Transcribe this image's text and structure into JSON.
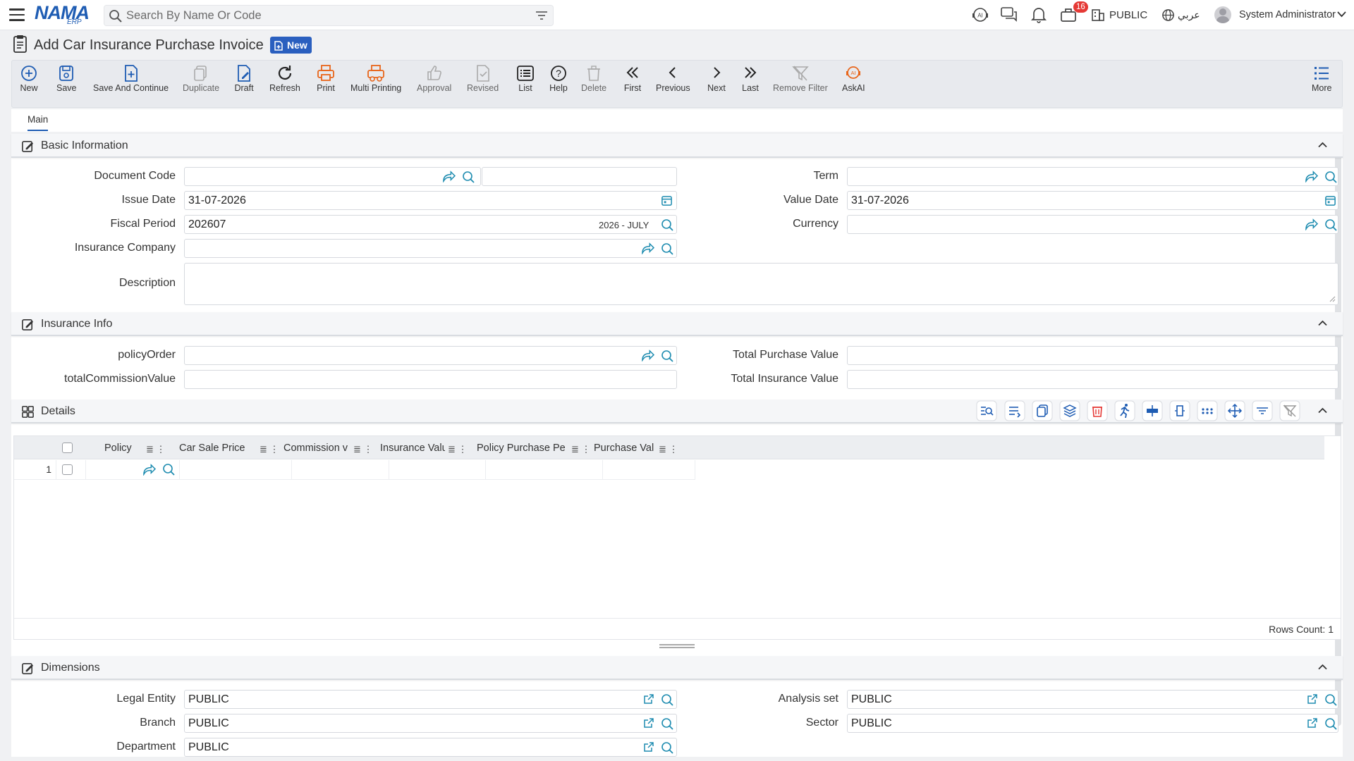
{
  "topbar": {
    "logo_main": "NAMA",
    "logo_sub": "ERP",
    "search_placeholder": "Search By Name Or Code",
    "notification_count": "16",
    "company": "PUBLIC",
    "language": "عربي",
    "user": "System Administrator"
  },
  "page": {
    "title": "Add Car Insurance Purchase Invoice",
    "status_badge": "New"
  },
  "toolbar": [
    {
      "label": "New"
    },
    {
      "label": "Save"
    },
    {
      "label": "Save And Continue"
    },
    {
      "label": "Duplicate"
    },
    {
      "label": "Draft"
    },
    {
      "label": "Refresh"
    },
    {
      "label": "Print"
    },
    {
      "label": "Multi Printing"
    },
    {
      "label": "Approval"
    },
    {
      "label": "Revised"
    },
    {
      "label": "List"
    },
    {
      "label": "Help"
    },
    {
      "label": "Delete"
    },
    {
      "label": "First"
    },
    {
      "label": "Previous"
    },
    {
      "label": "Next"
    },
    {
      "label": "Last"
    },
    {
      "label": "Remove Filter"
    },
    {
      "label": "AskAI"
    },
    {
      "label": "More"
    }
  ],
  "tabs": [
    {
      "label": "Main"
    }
  ],
  "basic_info": {
    "title": "Basic Information",
    "document_code": {
      "label": "Document Code",
      "value": ""
    },
    "issue_date": {
      "label": "Issue Date",
      "value": "31-07-2026"
    },
    "fiscal_period": {
      "label": "Fiscal Period",
      "value": "202607",
      "suffix": "2026 - JULY"
    },
    "insurance_company": {
      "label": "Insurance Company",
      "value": ""
    },
    "description": {
      "label": "Description",
      "value": ""
    },
    "term": {
      "label": "Term",
      "value": ""
    },
    "value_date": {
      "label": "Value Date",
      "value": "31-07-2026"
    },
    "currency": {
      "label": "Currency",
      "value": ""
    }
  },
  "insurance_info": {
    "title": "Insurance Info",
    "policy_order": {
      "label": "policyOrder",
      "value": ""
    },
    "total_commission": {
      "label": "totalCommissionValue",
      "value": ""
    },
    "total_purchase": {
      "label": "Total Purchase Value",
      "value": ""
    },
    "total_insurance": {
      "label": "Total Insurance Value",
      "value": ""
    }
  },
  "details": {
    "title": "Details",
    "columns": [
      "Policy",
      "Car Sale Price",
      "Commission v",
      "Insurance Valu",
      "Policy Purchase Pe",
      "Purchase Val"
    ],
    "rows": [
      {
        "num": "1"
      }
    ],
    "rows_count": "Rows Count: 1"
  },
  "dimensions": {
    "title": "Dimensions",
    "legal_entity": {
      "label": "Legal Entity",
      "value": "PUBLIC"
    },
    "branch": {
      "label": "Branch",
      "value": "PUBLIC"
    },
    "department": {
      "label": "Department",
      "value": "PUBLIC"
    },
    "analysis_set": {
      "label": "Analysis set",
      "value": "PUBLIC"
    },
    "sector": {
      "label": "Sector",
      "value": "PUBLIC"
    }
  },
  "colors": {
    "brand": "#1e5cb3",
    "accent_orange": "#e8651a",
    "danger": "#e53935",
    "teal": "#1e8cb0"
  }
}
